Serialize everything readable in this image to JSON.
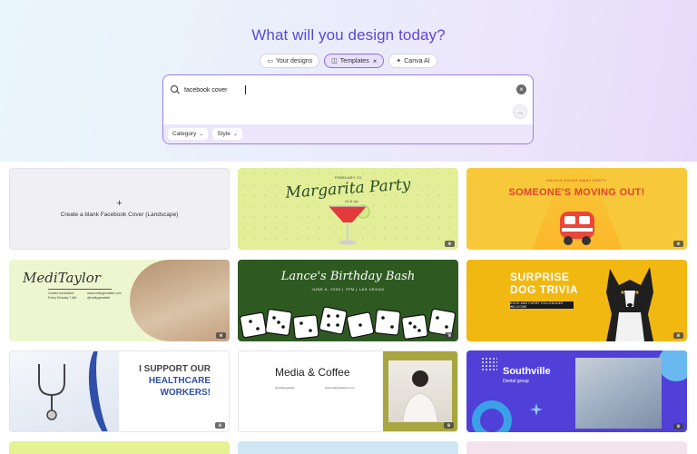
{
  "header": {
    "title": "What will you design today?"
  },
  "tabs": [
    {
      "label": "Your designs",
      "icon": "folder-icon",
      "active": false
    },
    {
      "label": "Templates",
      "icon": "template-icon",
      "active": true,
      "close": "×"
    },
    {
      "label": "Canva AI",
      "icon": "sparkle-icon",
      "active": false
    }
  ],
  "search": {
    "value": "facebook cover",
    "clear_icon": "×",
    "submit_icon": "→"
  },
  "filters": [
    {
      "label": "Category"
    },
    {
      "label": "Style"
    }
  ],
  "templates": {
    "blank": {
      "plus": "+",
      "label": "Create a blank Facebook Cover (Landscape)"
    },
    "margarita": {
      "tiny": "FEBRUARY 23",
      "title": "Margarita Party",
      "sub": "21 & Up"
    },
    "moving": {
      "tiny": "MAYA'S GOING AWAY PARTY",
      "title": "SOMEONE'S MOVING OUT!"
    },
    "medi": {
      "name": "MediTaylor",
      "s1": "Guided meditation",
      "s2": "Every Monday 7 AM",
      "s3": "www.reallygreatsite.com",
      "s4": "@reallygreatsite"
    },
    "bday": {
      "title": "Lance's Birthday Bash",
      "sub": "JUNE 6, 2030 | 7PM | LAS VEGAS"
    },
    "dog": {
      "title1": "SURPRISE",
      "title2": "DOG TRIVIA",
      "bar": "DOGS AND FURRY COLLEAGUES WELCOME"
    },
    "health": {
      "t1": "I SUPPORT OUR",
      "t2": "HEALTHCARE",
      "t3": "WORKERS!"
    },
    "media": {
      "title": "Media  & Coffee",
      "l1": "@reallygreatsite",
      "l2": "www.reallygreatsite.com"
    },
    "south": {
      "title": "Southville",
      "sub": "Dental group"
    }
  },
  "colors": {
    "accent": "#8b6ee6",
    "title_gradient_start": "#3d5ad6",
    "title_gradient_end": "#7a3fd0"
  }
}
